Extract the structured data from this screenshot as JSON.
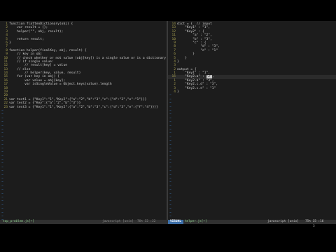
{
  "left_pane": {
    "lines": [
      {
        "n": "1",
        "text": "function flattenDictionary(obj) {"
      },
      {
        "n": "2",
        "text": "    var result = {};"
      },
      {
        "n": "3",
        "text": "    helper(\"\", obj, result);"
      },
      {
        "n": "4",
        "text": ""
      },
      {
        "n": "5",
        "text": "    return result;"
      },
      {
        "n": "6",
        "text": "}"
      },
      {
        "n": "7",
        "text": ""
      },
      {
        "n": "8",
        "text": "function helper(finalKey, obj, result) {"
      },
      {
        "n": "9",
        "text": "    // key in obj"
      },
      {
        "n": "10",
        "text": "    // check whether or not value (obj[key]) is a single value or is a dictionary"
      },
      {
        "n": "11",
        "text": "    // if single value:"
      },
      {
        "n": "12",
        "text": "        // result[key] = value"
      },
      {
        "n": "13",
        "text": "    // else"
      },
      {
        "n": "14",
        "text": "        // helper(key, value, result)"
      },
      {
        "n": "15",
        "text": "    for (var key in obj) {"
      },
      {
        "n": "16",
        "text": "        var value = obj[key];"
      },
      {
        "n": "17",
        "text": "        var isSingleValue = Object.keys(value).length"
      },
      {
        "n": "18",
        "text": ""
      },
      {
        "n": "19",
        "text": ""
      },
      {
        "n": "20",
        "text": ""
      },
      {
        "n": "21",
        "text": "var test1 = {\"Key1\":\"1\",\"Key2\":{\"a\":\"2\",\"b\":\"3\",\"c\":{\"d\":\"3\",\"e\":\"1\"}}}"
      },
      {
        "n": "22",
        "text": "var test2 = {\"Key\":{\"a\":\"2\",\"b\":\"3\"}}"
      },
      {
        "n": "23",
        "text": "var test3 = {\"Key1\":\"1\",\"Key2\":{\"a\":\"2\",\"b\":\"3\",\"c\":{\"d\":\"3\",\"e\":{\"f\":\"4\"}}}}"
      }
    ],
    "empty_line_marker": "~",
    "empty_line_count": 36
  },
  "right_pane": {
    "lines": [
      {
        "n": "14",
        "text": "dict = {  // input"
      },
      {
        "n": "13",
        "text": "    \"Key1\" : \"1\","
      },
      {
        "n": "12",
        "text": "    \"Key2\" : {"
      },
      {
        "n": "11",
        "text": "        \"a\" : \"2\","
      },
      {
        "n": "10",
        "text": "        \"b\" : \"3\","
      },
      {
        "n": "9",
        "text": "        \"c\" : {"
      },
      {
        "n": "8",
        "text": "            \"d\" : \"3\","
      },
      {
        "n": "7",
        "text": "            \"e\" : \"1\""
      },
      {
        "n": "6",
        "text": "        }"
      },
      {
        "n": "5",
        "text": "    }"
      },
      {
        "n": "4",
        "text": "}"
      },
      {
        "n": "3",
        "text": ""
      },
      {
        "n": "2",
        "text": "output = {"
      },
      {
        "n": "1",
        "text": "    \"Key1\" : \"1\","
      },
      {
        "n": "15",
        "text": "    \"Key2.a\" : \"2\",",
        "cursor": true,
        "selected": "\"2\""
      },
      {
        "n": "1",
        "text": "    \"Key2.b\" : \"3\","
      },
      {
        "n": "2",
        "text": "    \"Key2.c.d\" : \"3\","
      },
      {
        "n": "3",
        "text": "    \"Key2.c.e\" : \"1\""
      },
      {
        "n": "4",
        "text": "}"
      }
    ],
    "empty_line_marker": "~",
    "empty_line_count": 33
  },
  "status_left": {
    "file": "top_problem.js[+]",
    "filetype": "javascript  [unix]",
    "position": "76% 32 :22"
  },
  "status_right": {
    "mode": "VISUAL",
    "file": "helper.js[+]",
    "filetype": "javascript  [unix]",
    "position": "75% 15 :16"
  },
  "cmdline": {
    "count": "3"
  },
  "colors": {
    "background": "#1c1c1c",
    "line_number": "#a8a050",
    "tilde": "#3a6ea5",
    "visual_mode": "#3d6fa8",
    "filename": "#8fd08f"
  }
}
